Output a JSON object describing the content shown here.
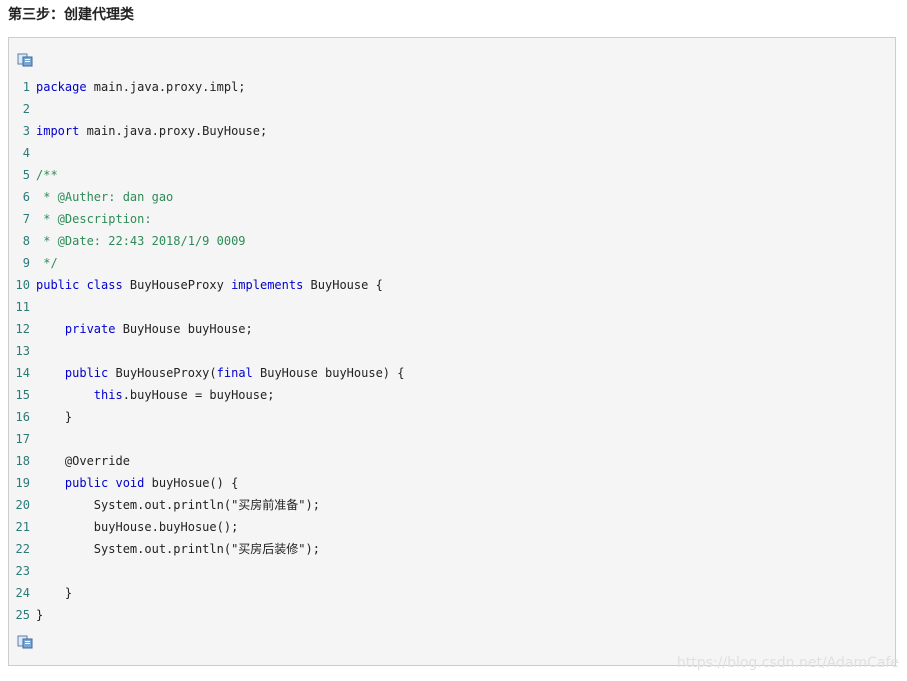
{
  "heading": "第三步：创建代理类",
  "copy_icon_name": "copy-icon",
  "code_lines": [
    [
      {
        "t": "package",
        "c": "kw"
      },
      {
        "t": " main.java.proxy.impl;",
        "c": "tx"
      }
    ],
    [],
    [
      {
        "t": "import",
        "c": "kw"
      },
      {
        "t": " main.java.proxy.BuyHouse;",
        "c": "tx"
      }
    ],
    [],
    [
      {
        "t": "/**",
        "c": "cm"
      }
    ],
    [
      {
        "t": " * @Auther: dan gao",
        "c": "cm"
      }
    ],
    [
      {
        "t": " * @Description:",
        "c": "cm"
      }
    ],
    [
      {
        "t": " * @Date: 22:43 2018/1/9 0009",
        "c": "cm"
      }
    ],
    [
      {
        "t": " */",
        "c": "cm"
      }
    ],
    [
      {
        "t": "public class",
        "c": "kw"
      },
      {
        "t": " BuyHouseProxy ",
        "c": "tx"
      },
      {
        "t": "implements",
        "c": "kw"
      },
      {
        "t": " BuyHouse {",
        "c": "tx"
      }
    ],
    [],
    [
      {
        "t": "    ",
        "c": "tx"
      },
      {
        "t": "private",
        "c": "kw"
      },
      {
        "t": " BuyHouse buyHouse;",
        "c": "tx"
      }
    ],
    [],
    [
      {
        "t": "    ",
        "c": "tx"
      },
      {
        "t": "public",
        "c": "kw"
      },
      {
        "t": " BuyHouseProxy(",
        "c": "tx"
      },
      {
        "t": "final",
        "c": "kw"
      },
      {
        "t": " BuyHouse buyHouse) {",
        "c": "tx"
      }
    ],
    [
      {
        "t": "        ",
        "c": "tx"
      },
      {
        "t": "this",
        "c": "kw"
      },
      {
        "t": ".buyHouse = buyHouse;",
        "c": "tx"
      }
    ],
    [
      {
        "t": "    }",
        "c": "tx"
      }
    ],
    [],
    [
      {
        "t": "    @Override",
        "c": "tx"
      }
    ],
    [
      {
        "t": "    ",
        "c": "tx"
      },
      {
        "t": "public void",
        "c": "kw"
      },
      {
        "t": " buyHosue() {",
        "c": "tx"
      }
    ],
    [
      {
        "t": "        System.out.println(\"买房前准备\");",
        "c": "tx"
      }
    ],
    [
      {
        "t": "        buyHouse.buyHosue();",
        "c": "tx"
      }
    ],
    [
      {
        "t": "        System.out.println(\"买房后装修\");",
        "c": "tx"
      }
    ],
    [],
    [
      {
        "t": "    }",
        "c": "tx"
      }
    ],
    [
      {
        "t": "}",
        "c": "tx"
      }
    ]
  ],
  "watermark": "https://blog.csdn.net/AdamCafe",
  "colors": {
    "keyword": "#0000cc",
    "comment": "#2e8b57",
    "line_number": "#2b7a7a",
    "background": "#f5f5f5"
  }
}
